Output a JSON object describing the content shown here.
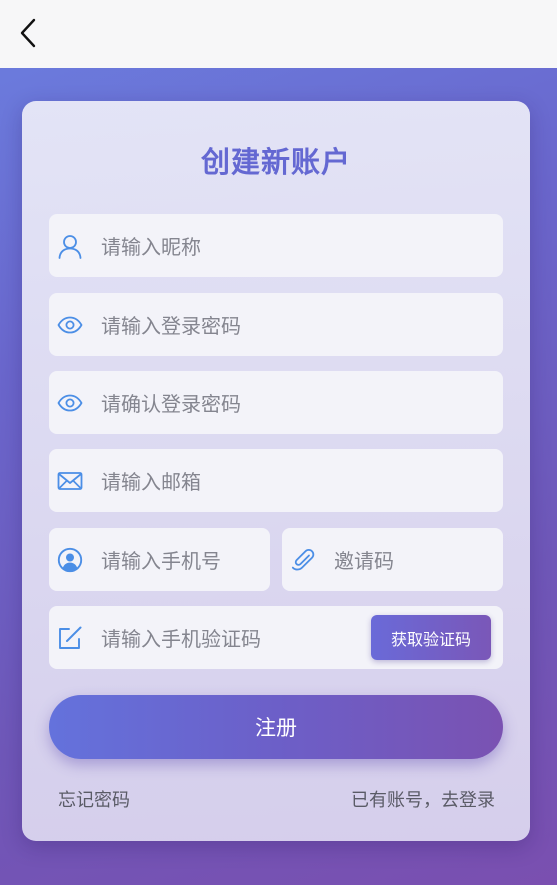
{
  "form": {
    "title": "创建新账户",
    "nickname_placeholder": "请输入昵称",
    "password_placeholder": "请输入登录密码",
    "confirm_password_placeholder": "请确认登录密码",
    "email_placeholder": "请输入邮箱",
    "phone_placeholder": "请输入手机号",
    "invite_placeholder": "邀请码",
    "sms_code_placeholder": "请输入手机验证码",
    "get_code_label": "获取验证码",
    "register_label": "注册",
    "forgot_password_label": "忘记密码",
    "login_link_label": "已有账号，去登录"
  },
  "icons": {
    "back": "chevron-left-icon",
    "nickname": "user-icon",
    "password": "eye-icon",
    "confirm_password": "eye-icon",
    "email": "mail-icon",
    "phone": "user-circle-icon",
    "invite": "paperclip-icon",
    "sms_code": "edit-icon"
  },
  "colors": {
    "accent": "#6468d2",
    "icon": "#4b8ee6",
    "background_start": "#6b7fe0",
    "background_end": "#7a4fb0"
  }
}
